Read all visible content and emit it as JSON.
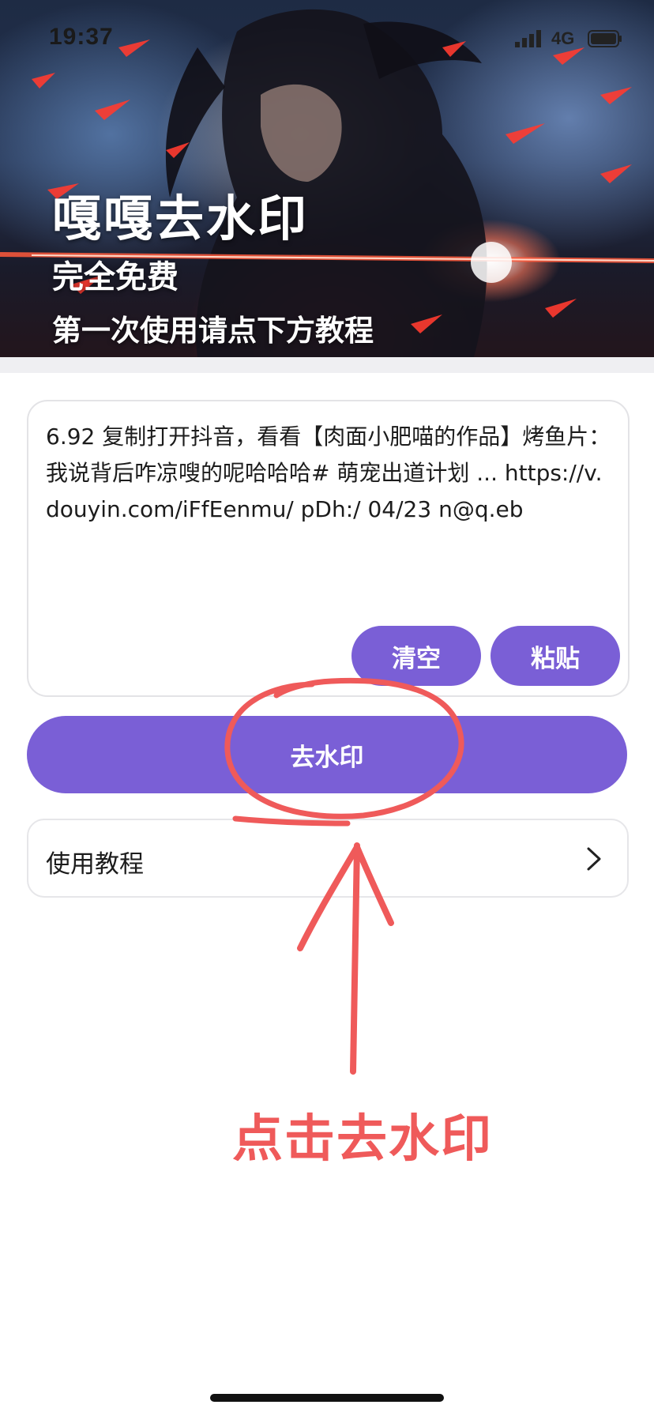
{
  "status_bar": {
    "time": "19:37",
    "network": "4G",
    "signal_icon": "cellular-signal-icon",
    "battery_icon": "battery-icon"
  },
  "hero": {
    "title": "嘎嘎去水印",
    "subtitle": "完全免费",
    "tip": "第一次使用请点下方教程",
    "art_icon": "anime-swordsman-illustration"
  },
  "input": {
    "value": "6.92 复制打开抖音，看看【肉面小肥喵的作品】烤鱼片：我说背后咋凉嗖的呢哈哈哈# 萌宠出道计划 ... https://v.douyin.com/iFfEenmu/ pDh:/ 04/23 n@q.eb",
    "clear_label": "清空",
    "paste_label": "粘贴"
  },
  "actions": {
    "remove_watermark_label": "去水印"
  },
  "tutorial": {
    "label": "使用教程",
    "icon": "chevron-right-icon"
  },
  "annotation": {
    "text": "点击去水印",
    "color": "#ef5a5a"
  },
  "colors": {
    "accent": "#7a5fd6",
    "annotation": "#ef5a5a"
  }
}
